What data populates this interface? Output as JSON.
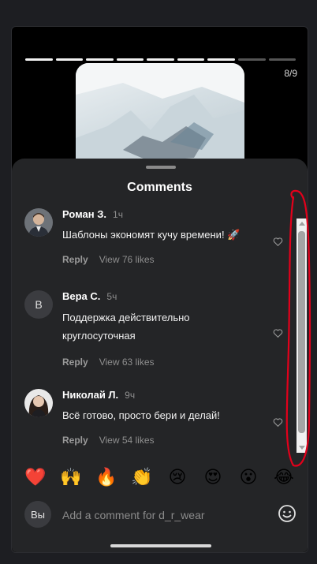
{
  "story": {
    "counter": "8/9",
    "segments_total": 9,
    "segments_done": 7
  },
  "sheet": {
    "title": "Comments"
  },
  "comments": [
    {
      "name": "Роман З.",
      "time": "1ч",
      "text": "Шаблоны экономят кучу времени! 🚀",
      "reply": "Reply",
      "likes": "View 76 likes",
      "avatar_initial": ""
    },
    {
      "name": "Вера С.",
      "time": "5ч",
      "text": "Поддержка действительно круглосуточная",
      "reply": "Reply",
      "likes": "View 63 likes",
      "avatar_initial": "В"
    },
    {
      "name": "Николай Л.",
      "time": "9ч",
      "text": "Всё готово, просто бери и делай!",
      "reply": "Reply",
      "likes": "View 54 likes",
      "avatar_initial": ""
    }
  ],
  "reactions": [
    "❤️",
    "🙌",
    "🔥",
    "👏",
    "😢",
    "😍",
    "😮",
    "😂"
  ],
  "composer": {
    "avatar_label": "Вы",
    "placeholder": "Add a comment for d_r_wear"
  },
  "colors": {
    "sheet_bg": "#242527",
    "annotation_red": "#e3001b"
  }
}
